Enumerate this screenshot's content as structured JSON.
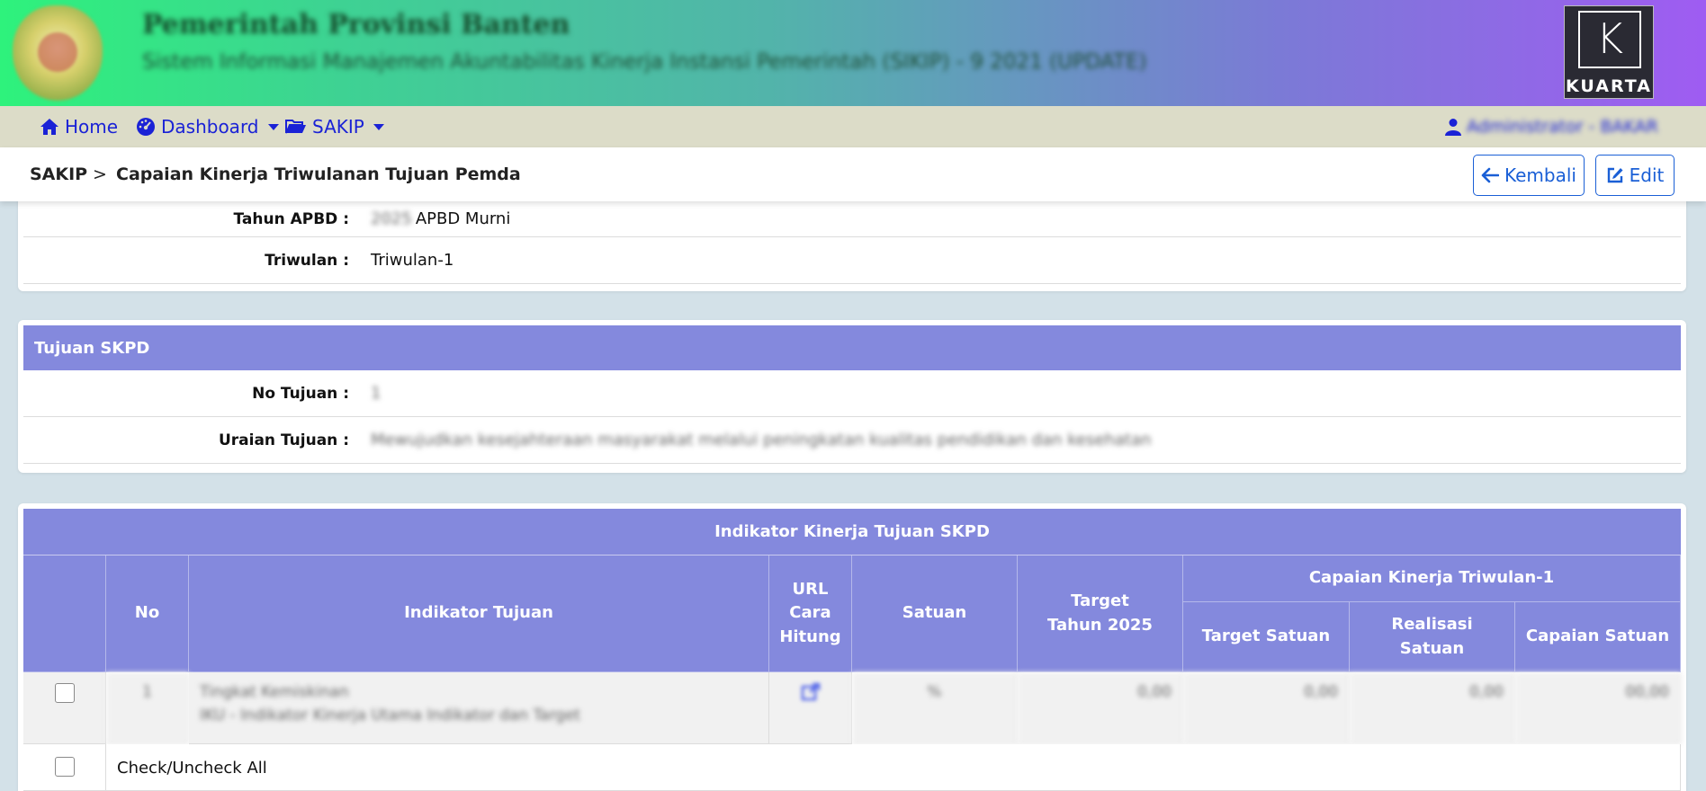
{
  "banner": {
    "title": "Pemerintah Provinsi Banten",
    "subtitle": "Sistem Informasi Manajemen Akuntabilitas Kinerja Instansi Pemerintah (SIKIP) - 9 2021 (UPDATE)",
    "brand_letter": "K",
    "brand_name": "KUARTA"
  },
  "nav": {
    "home": "Home",
    "dashboard": "Dashboard",
    "sakip": "SAKIP",
    "user": "Administrator - BAKAR"
  },
  "breadcrumb": {
    "root": "SAKIP",
    "separator": ">",
    "current": "Capaian Kinerja Triwulanan Tujuan Pemda",
    "back_button": "Kembali",
    "edit_button": "Edit"
  },
  "info": {
    "tahun_label": "Tahun APBD :",
    "tahun_year": "2025",
    "tahun_value": "APBD Murni",
    "triwulan_label": "Triwulan :",
    "triwulan_value": "Triwulan-1"
  },
  "tujuan": {
    "header": "Tujuan SKPD",
    "no_label": "No Tujuan :",
    "no_value": "1",
    "uraian_label": "Uraian Tujuan :",
    "uraian_value": "Mewujudkan kesejahteraan masyarakat melalui peningkatan kualitas pendidikan dan kesehatan"
  },
  "indikator": {
    "title": "Indikator Kinerja Tujuan SKPD",
    "columns": {
      "no": "No",
      "indikator": "Indikator Tujuan",
      "url_line1": "URL",
      "url_line2": "Cara",
      "url_line3": "Hitung",
      "satuan": "Satuan",
      "target_line1": "Target",
      "target_line2": "Tahun 2025",
      "capaian_group": "Capaian Kinerja Triwulan-1",
      "target_satuan": "Target Satuan",
      "realisasi_line1": "Realisasi",
      "realisasi_line2": "Satuan",
      "capaian_satuan": "Capaian Satuan"
    },
    "rows": [
      {
        "no": "1",
        "indikator_line1": "Tingkat Kemiskinan",
        "indikator_line2": "IKU - Indikator Kinerja Utama Indikator dan Target",
        "satuan": "%",
        "target": "0,00",
        "target_satuan": "0,00",
        "realisasi_satuan": "0,00",
        "capaian_satuan": "00,00"
      }
    ],
    "check_all": "Check/Uncheck All"
  },
  "colors": {
    "header_purple": "#8489dd",
    "link_blue": "#1a22d6",
    "button_blue": "#1a5fd6",
    "navbar_bg": "#dcdcc8"
  }
}
